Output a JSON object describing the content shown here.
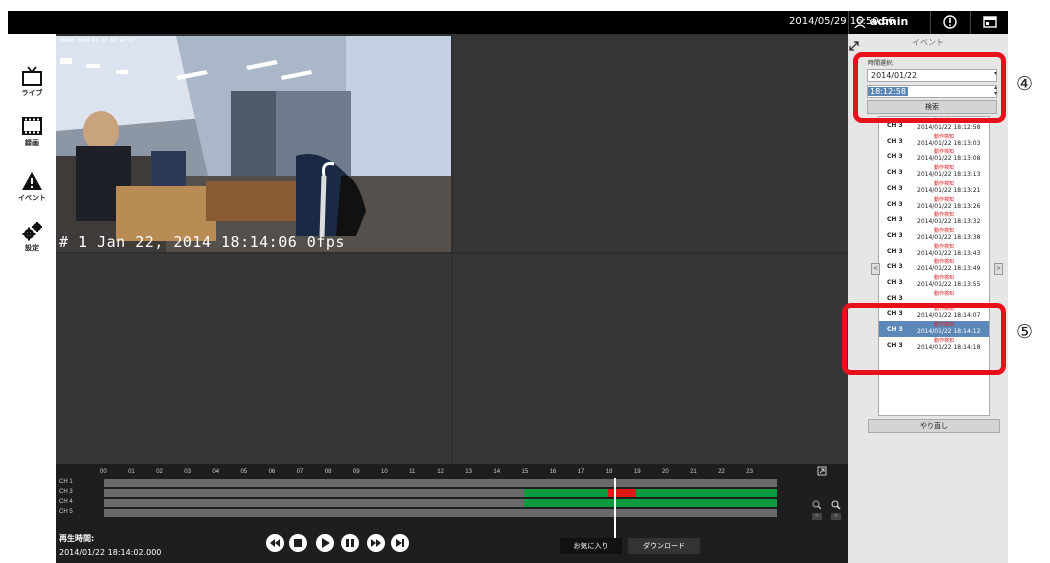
{
  "topbar": {
    "datetime": "2014/05/29 16:50:56",
    "user": "admin",
    "info_icon": "info-icon",
    "menu_icon": "window-icon"
  },
  "sidebar": {
    "items": [
      {
        "label": "ライブ",
        "icon": "tv-icon"
      },
      {
        "label": "録画",
        "icon": "film-icon"
      },
      {
        "label": "イベント",
        "icon": "warning-icon"
      },
      {
        "label": "設定",
        "icon": "gears-icon"
      }
    ]
  },
  "video": {
    "osd_top": "50080 2014-01-22 18:14:37",
    "osd_bottom": "# 1 Jan 22, 2014 18:14:06   0fps"
  },
  "timeline": {
    "hours": [
      "00",
      "01",
      "02",
      "03",
      "04",
      "05",
      "06",
      "07",
      "08",
      "09",
      "10",
      "11",
      "12",
      "13",
      "14",
      "15",
      "16",
      "17",
      "18",
      "19",
      "20",
      "21",
      "22",
      "23"
    ],
    "channels": [
      "CH 1",
      "CH 3",
      "CH 4",
      "CH 5"
    ],
    "playback_label": "再生時間:",
    "playback_time": "2014/01/22 18:14:02.000",
    "favorite_button": "お気に入り",
    "download_button": "ダウンロード"
  },
  "event_panel": {
    "title": "イベント",
    "select_label": "時間選択:",
    "date_value": "2014/01/22",
    "time_value": "18:12:58",
    "search_button": "検索",
    "events": [
      {
        "ch": "CH 3",
        "type": "動作検知",
        "time": "2014/01/22 18:12:58"
      },
      {
        "ch": "CH 3",
        "type": "動作検知",
        "time": "2014/01/22 18:13:03"
      },
      {
        "ch": "CH 3",
        "type": "動作検知",
        "time": "2014/01/22 18:13:08"
      },
      {
        "ch": "CH 3",
        "type": "動作検知",
        "time": "2014/01/22 18:13:13"
      },
      {
        "ch": "CH 3",
        "type": "動作検知",
        "time": "2014/01/22 18:13:21"
      },
      {
        "ch": "CH 3",
        "type": "動作検知",
        "time": "2014/01/22 18:13:26"
      },
      {
        "ch": "CH 3",
        "type": "動作検知",
        "time": "2014/01/22 18:13:32"
      },
      {
        "ch": "CH 3",
        "type": "動作検知",
        "time": "2014/01/22 18:13:38"
      },
      {
        "ch": "CH 3",
        "type": "動作検知",
        "time": "2014/01/22 18:13:43"
      },
      {
        "ch": "CH 3",
        "type": "動作検知",
        "time": "2014/01/22 18:13:49"
      },
      {
        "ch": "CH 3",
        "type": "動作検知",
        "time": "2014/01/22 18:13:55"
      },
      {
        "ch": "CH 3",
        "type": "動作検知",
        "time": ""
      },
      {
        "ch": "CH 3",
        "type": "動作検知",
        "time": "2014/01/22 18:14:07"
      },
      {
        "ch": "CH 3",
        "type": "動作検知",
        "time": "2014/01/22 18:14:12"
      },
      {
        "ch": "CH 3",
        "type": "動作検知",
        "time": "2014/01/22 18:14:18"
      }
    ],
    "selected_index": 13,
    "redo_button": "やり直し"
  },
  "callouts": {
    "four": "④",
    "five": "⑤"
  },
  "colors": {
    "highlight": "#e8101a",
    "green": "#0c9a3e",
    "red": "#e01818",
    "selected_row": "#5b88b8"
  }
}
